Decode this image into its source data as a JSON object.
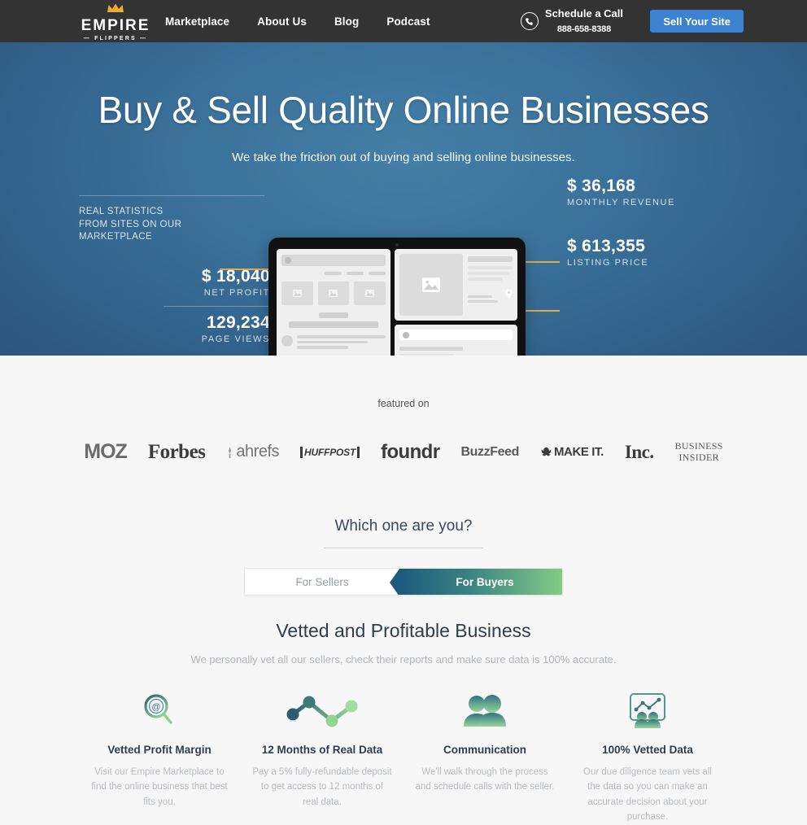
{
  "header": {
    "logo": {
      "word": "EMPIRE",
      "sub": "— FLIPPERS —",
      "icon": "crown-icon"
    },
    "nav": [
      {
        "label": "Marketplace"
      },
      {
        "label": "About Us"
      },
      {
        "label": "Blog"
      },
      {
        "label": "Podcast"
      }
    ],
    "call": {
      "icon": "phone-icon",
      "title": "Schedule a Call",
      "number": "888-658-8388"
    },
    "cta": {
      "label": "Sell Your Site",
      "color": "#3b82d1"
    }
  },
  "hero": {
    "title": "Buy & Sell Quality Online Businesses",
    "subtitle": "We take the friction out of buying and selling online businesses.",
    "kicker": "REAL STATISTICS\nFROM SITES ON OUR\nMARKETPLACE",
    "kicker_line1": "REAL STATISTICS",
    "kicker_line2": "FROM SITES ON OUR",
    "kicker_line3": "MARKETPLACE",
    "accent_color": "#e3a84a",
    "bg_color": "#3a7099",
    "stats_left": [
      {
        "value": "$ 18,040",
        "label": "NET PROFIT"
      },
      {
        "value": "129,234",
        "label": "PAGE VIEWS"
      }
    ],
    "stats_right": [
      {
        "value": "$ 36,168",
        "label": "MONTHLY REVENUE"
      },
      {
        "value": "$ 613,355",
        "label": "LISTING PRICE"
      }
    ]
  },
  "featured": {
    "label": "featured on",
    "logos": [
      {
        "name": "moz",
        "text": "MOZ"
      },
      {
        "name": "forbes",
        "text": "Forbes"
      },
      {
        "name": "ahrefs",
        "text": "ahrefs"
      },
      {
        "name": "huffpost",
        "text": "HUFFPOST"
      },
      {
        "name": "foundr",
        "text": "foundr"
      },
      {
        "name": "buzzfeed",
        "text": "BuzzFeed"
      },
      {
        "name": "makeit",
        "text": "MAKE IT."
      },
      {
        "name": "inc",
        "text": "Inc."
      },
      {
        "name": "bi_line1",
        "text": "BUSINESS"
      },
      {
        "name": "bi_line2",
        "text": "INSIDER"
      }
    ]
  },
  "which_one": {
    "title": "Which one are you?",
    "toggle": {
      "sellers_label": "For Sellers",
      "buyers_label": "For Buyers",
      "active": "For Buyers",
      "active_gradient_from": "#1c5b7d",
      "active_gradient_to": "#84cb87"
    }
  },
  "vetted": {
    "title": "Vetted and Profitable Business",
    "subtitle": "We personally vet all our sellers, check their reports and make sure data is 100% accurate.",
    "features": [
      {
        "icon": "magnifier-at-icon",
        "title": "Vetted Profit Margin",
        "desc": "Visit our Empire Marketplace to find the online business that best fits you."
      },
      {
        "icon": "line-chart-dots-icon",
        "title": "12 Months of Real Data",
        "desc": "Pay a 5% fully-refundable deposit to get access to 12 months of real data."
      },
      {
        "icon": "two-people-icon",
        "title": "Communication",
        "desc": "We'll walk through the process and schedule calls with the seller."
      },
      {
        "icon": "chart-board-people-icon",
        "title": "100% Vetted Data",
        "desc": "Our due diligence team vets all the data so you can make an accurate decision about your purchase."
      }
    ]
  }
}
